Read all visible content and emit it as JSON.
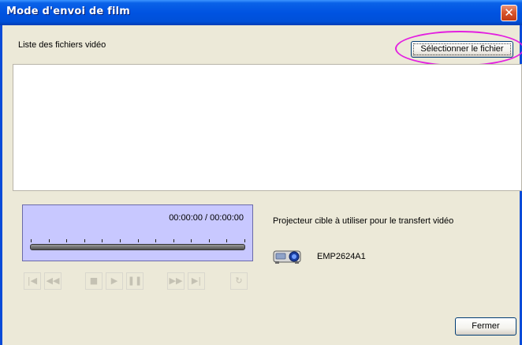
{
  "window": {
    "title": "Mode d'envoi de film",
    "close_glyph": "✕",
    "close_icon": "close-icon"
  },
  "file_list": {
    "label": "Liste des fichiers vidéo",
    "select_button": "Sélectionner le fichier",
    "items": []
  },
  "player": {
    "time": "00:00:00 / 00:00:00",
    "progress": 0,
    "buttons": [
      {
        "name": "skip-start-button",
        "icon": "skip-start-icon",
        "glyph": "|◀"
      },
      {
        "name": "rewind-button",
        "icon": "rewind-icon",
        "glyph": "◀◀"
      },
      {
        "name": "stop-button",
        "icon": "stop-icon",
        "glyph": "■"
      },
      {
        "name": "play-button",
        "icon": "play-icon",
        "glyph": "▶"
      },
      {
        "name": "pause-button",
        "icon": "pause-icon",
        "glyph": "❚❚"
      },
      {
        "name": "fast-forward-button",
        "icon": "fast-forward-icon",
        "glyph": "▶▶"
      },
      {
        "name": "skip-end-button",
        "icon": "skip-end-icon",
        "glyph": "▶|"
      },
      {
        "name": "repeat-button",
        "icon": "repeat-icon",
        "glyph": "↻"
      }
    ]
  },
  "projector": {
    "label": "Projecteur cible à utiliser pour le transfert vidéo",
    "name": "EMP2624A1",
    "icon": "projector-icon"
  },
  "footer": {
    "close_button": "Fermer"
  },
  "colors": {
    "titlebar": "#0053E1",
    "highlight": "#E31FE0",
    "timeline_bg": "#C8C8FF",
    "window_bg": "#ECE9D8"
  }
}
